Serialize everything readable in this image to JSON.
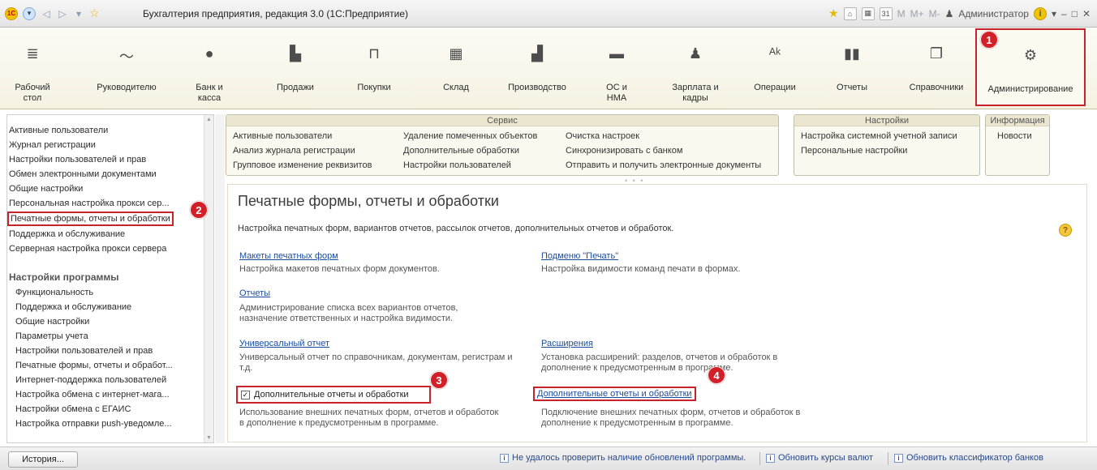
{
  "window": {
    "title": "Бухгалтерия предприятия, редакция 3.0  (1С:Предприятие)",
    "user": "Администратор",
    "calc_buttons": [
      "M",
      "M+",
      "M-"
    ]
  },
  "sections": [
    {
      "label": "Рабочий стол",
      "icon": "list-icon"
    },
    {
      "label": "Руководителю",
      "icon": "trend-icon"
    },
    {
      "label": "Банк и касса",
      "icon": "coin-icon"
    },
    {
      "label": "Продажи",
      "icon": "bag-icon"
    },
    {
      "label": "Покупки",
      "icon": "cart-icon"
    },
    {
      "label": "Склад",
      "icon": "warehouse-icon"
    },
    {
      "label": "Производство",
      "icon": "factory-icon"
    },
    {
      "label": "ОС и НМА",
      "icon": "truck-icon"
    },
    {
      "label": "Зарплата и кадры",
      "icon": "person-icon"
    },
    {
      "label": "Операции",
      "icon": "operations-icon"
    },
    {
      "label": "Отчеты",
      "icon": "bar-chart-icon"
    },
    {
      "label": "Справочники",
      "icon": "book-icon"
    },
    {
      "label": "Администрирование",
      "icon": "gear-icon"
    }
  ],
  "badges": [
    "1",
    "2",
    "3",
    "4"
  ],
  "nav": {
    "items": [
      "Активные пользователи",
      "Журнал регистрации",
      "Настройки пользователей и прав",
      "Обмен электронными документами",
      "Общие настройки",
      "Персональная настройка прокси сер...",
      "Печатные формы, отчеты и обработки",
      "Поддержка и обслуживание",
      "Серверная настройка прокси сервера"
    ],
    "group_title": "Настройки программы",
    "group_items": [
      "Функциональность",
      "Поддержка и обслуживание",
      "Общие настройки",
      "Параметры учета",
      "Настройки пользователей и прав",
      "Печатные формы, отчеты и обработ...",
      "Интернет-поддержка пользователей",
      "Настройка обмена с интернет-мага...",
      "Настройки обмена с ЕГАИС",
      "Настройка отправки push-уведомле..."
    ]
  },
  "service": {
    "title": "Сервис",
    "col1": [
      "Активные пользователи",
      "Анализ журнала регистрации",
      "Групповое изменение реквизитов"
    ],
    "col2": [
      "Удаление помеченных объектов",
      "Дополнительные обработки",
      "Настройки пользователей"
    ],
    "col3": [
      "Очистка настроек",
      "Синхронизировать с банком",
      "Отправить и получить электронные документы"
    ]
  },
  "settings": {
    "title": "Настройки",
    "items": [
      "Настройка системной учетной записи",
      "Персональные настройки"
    ]
  },
  "info": {
    "title": "Информация",
    "items": [
      "Новости"
    ]
  },
  "content": {
    "title": "Печатные формы, отчеты и обработки",
    "description": "Настройка печатных форм, вариантов отчетов, рассылок отчетов, дополнительных отчетов и обработок.",
    "links": {
      "print_layouts": {
        "label": "Макеты печатных форм",
        "desc": "Настройка макетов печатных форм документов."
      },
      "print_submenu": {
        "label": "Подменю \"Печать\"",
        "desc": "Настройка видимости команд печати в формах."
      },
      "reports": {
        "label": "Отчеты",
        "desc1": "Администрирование списка всех вариантов отчетов,",
        "desc2": "назначение ответственных и настройка видимости."
      },
      "universal_report": {
        "label": "Универсальный отчет",
        "desc1": "Универсальный отчет по справочникам, документам, регистрам и",
        "desc2": "т.д."
      },
      "extensions": {
        "label": "Расширения",
        "desc1": "Установка расширений: разделов, отчетов и обработок в",
        "desc2": "дополнение к предусмотренным в программе."
      },
      "additional_checkbox": {
        "label": "Дополнительные отчеты и обработки",
        "checked": true,
        "desc1": "Использование внешних печатных форм, отчетов и обработок",
        "desc2": "в дополнение к предусмотренным в программе."
      },
      "additional_link": {
        "label": "Дополнительные отчеты и обработки",
        "desc1": "Подключение внешних печатных форм, отчетов и обработок в",
        "desc2": "дополнение к предусмотренным в программе."
      }
    }
  },
  "statusbar": {
    "history": "История...",
    "items": [
      "Не удалось проверить наличие обновлений программы.",
      "Обновить курсы валют",
      "Обновить классификатор банков"
    ]
  },
  "colors": {
    "highlight": "#c8232a",
    "link": "#1a4c9e",
    "panel": "#f5f2e2"
  }
}
